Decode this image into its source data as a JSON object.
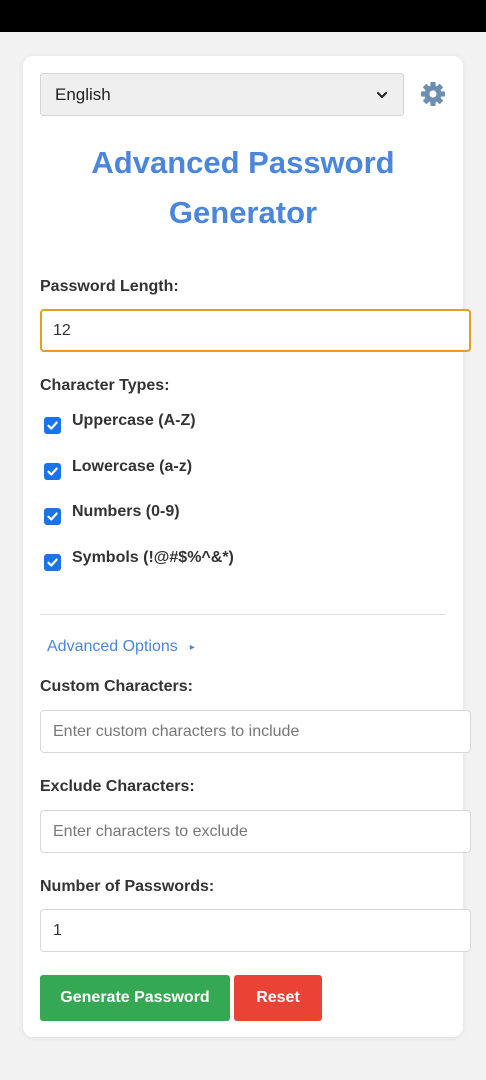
{
  "language_select": {
    "value": "English"
  },
  "title": "Advanced Password Generator",
  "password_length": {
    "label": "Password Length:",
    "value": "12"
  },
  "character_types": {
    "label": "Character Types:",
    "options": [
      {
        "label": "Uppercase (A-Z)",
        "checked": true
      },
      {
        "label": "Lowercase (a-z)",
        "checked": true
      },
      {
        "label": "Numbers (0-9)",
        "checked": true
      },
      {
        "label": "Symbols (!@#$%^&*)",
        "checked": true
      }
    ]
  },
  "advanced_options": {
    "label": "Advanced Options",
    "expanded_indicator": "▸"
  },
  "custom_characters": {
    "label": "Custom Characters:",
    "placeholder": "Enter custom characters to include",
    "value": ""
  },
  "exclude_characters": {
    "label": "Exclude Characters:",
    "placeholder": "Enter characters to exclude",
    "value": ""
  },
  "number_of_passwords": {
    "label": "Number of Passwords:",
    "value": "1"
  },
  "buttons": {
    "generate": "Generate Password",
    "reset": "Reset"
  },
  "colors": {
    "accent": "#4a86dc",
    "focus_border": "#e0a21a",
    "checkbox": "#1a73e8",
    "generate_button": "#34a853",
    "reset_button": "#ea4335"
  },
  "icons": {
    "settings": "gear-icon",
    "dropdown": "chevron-down-icon",
    "check": "check-icon"
  }
}
